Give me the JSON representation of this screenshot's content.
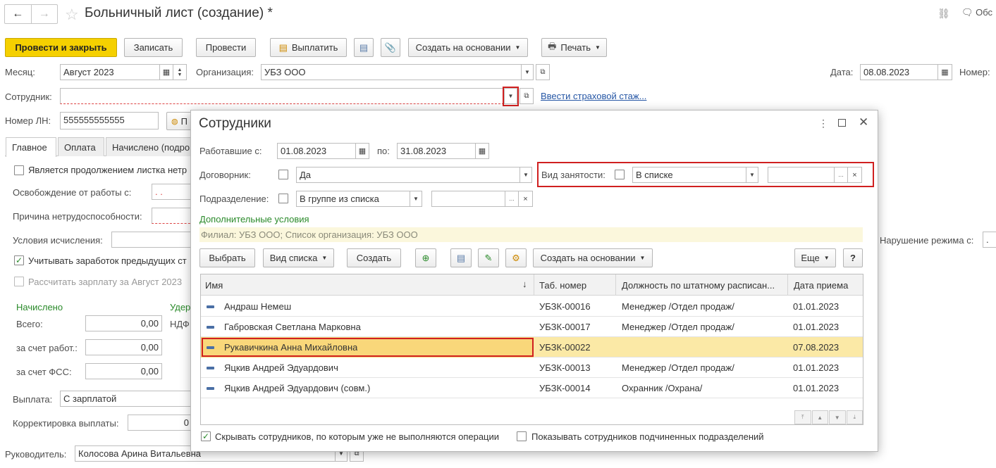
{
  "header": {
    "title": "Больничный лист (создание) *",
    "back": "←",
    "forward": "→",
    "star": "☆",
    "link_icon": "🔗",
    "discuss": "Обс"
  },
  "toolbar": {
    "post_close": "Провести и закрыть",
    "save": "Записать",
    "post": "Провести",
    "pay": "Выплатить",
    "create_based": "Создать на основании",
    "print": "Печать"
  },
  "form": {
    "month_label": "Месяц:",
    "month_value": "Август 2023",
    "org_label": "Организация:",
    "org_value": "УБЗ ООО",
    "date_label": "Дата:",
    "date_value": "08.08.2023",
    "number_label": "Номер:",
    "employee_label": "Сотрудник:",
    "employee_value": "",
    "insurance_link": "Ввести страховой стаж...",
    "ln_label": "Номер ЛН:",
    "ln_value": "555555555555",
    "ln_btn": "П"
  },
  "tabs": [
    "Главное",
    "Оплата",
    "Начислено (подро"
  ],
  "main": {
    "continuation": "Является продолжением листка нетр",
    "release_label": "Освобождение от работы с:",
    "release_value": " .  . ",
    "cause_label": "Причина нетрудоспособности:",
    "conditions_label": "Условия исчисления:",
    "consider": "Учитывать заработок предыдущих ст",
    "calc_salary": "Рассчитать зарплату за Август 2023",
    "accrued": "Начислено",
    "withheld": "Удер",
    "total_label": "Всего:",
    "total_value": "0,00",
    "ndfl": "НДФ",
    "employer_label": "за счет работ.:",
    "employer_value": "0,00",
    "fss_label": "за счет ФСС:",
    "fss_value": "0,00",
    "payout_label": "Выплата:",
    "payout_value": "С зарплатой",
    "correction_label": "Корректировка выплаты:",
    "correction_value": "0",
    "violation_label": "Нарушение режима с:",
    "head_label": "Руководитель:",
    "head_value": "Колосова Арина Витальевна"
  },
  "dialog": {
    "title": "Сотрудники",
    "worked_label": "Работавшие с:",
    "from": "01.08.2023",
    "to_label": "по:",
    "to": "31.08.2023",
    "contractor_label": "Договорник:",
    "contractor_value": "Да",
    "employment_label": "Вид занятости:",
    "employment_value": "В списке",
    "dept_label": "Подразделение:",
    "dept_value": "В группе из списка",
    "extra_conditions": "Дополнительные условия",
    "filter_info": "Филиал: УБЗ ООО; Список организация: УБЗ ООО",
    "buttons": {
      "select": "Выбрать",
      "list_view": "Вид списка",
      "create": "Создать",
      "create_based": "Создать на основании",
      "more": "Еще",
      "help": "?"
    },
    "columns": [
      "Имя",
      "Таб. номер",
      "Должность по штатному расписан...",
      "Дата приема"
    ],
    "rows": [
      {
        "name": "Андраш Немеш",
        "num": "УБЗК-00016",
        "pos": "Менеджер /Отдел продаж/",
        "date": "01.01.2023"
      },
      {
        "name": "Габровская Светлана Марковна",
        "num": "УБЗК-00017",
        "pos": "Менеджер /Отдел продаж/",
        "date": "01.01.2023"
      },
      {
        "name": "Рукавичкина Анна Михайловна",
        "num": "УБЗК-00022",
        "pos": "",
        "date": "07.08.2023"
      },
      {
        "name": "Яцкив Андрей Эдуардович",
        "num": "УБЗК-00013",
        "pos": "Менеджер /Отдел продаж/",
        "date": "01.01.2023"
      },
      {
        "name": "Яцкив Андрей Эдуардович (совм.)",
        "num": "УБЗК-00014",
        "pos": "Охранник /Охрана/",
        "date": "01.01.2023"
      }
    ],
    "hide_label": "Скрывать сотрудников, по которым уже не выполняются операции",
    "show_sub_label": "Показывать сотрудников подчиненных подразделений"
  },
  "colors": {
    "accent": "#f5d000",
    "selected_row": "#fbe9a6",
    "highlight": "#d02020",
    "link": "#2455a4"
  }
}
